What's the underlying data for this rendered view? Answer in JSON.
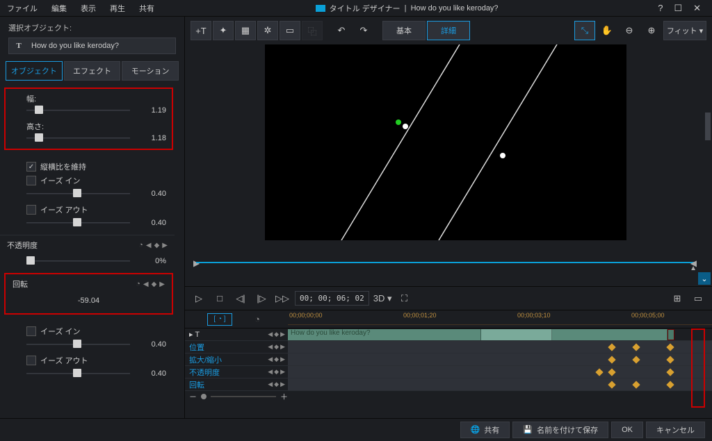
{
  "menu": {
    "file": "ファイル",
    "edit": "編集",
    "view": "表示",
    "play": "再生",
    "share": "共有"
  },
  "title": {
    "app": "タイトル デザイナー",
    "sep": "|",
    "doc": "How do you like keroday?"
  },
  "win": {
    "help": "?",
    "max": "☐",
    "close": "✕"
  },
  "selobj": {
    "heading": "選択オブジェクト:",
    "type": "T",
    "value": "How do you like keroday?"
  },
  "tabs": {
    "object": "オブジェクト",
    "effect": "エフェクト",
    "motion": "モーション"
  },
  "props": {
    "width_label": "幅:",
    "width": "1.19",
    "width_pct": 8,
    "height_label": "高さ:",
    "height": "1.18",
    "height_pct": 8,
    "keepratio": "縦横比を維持",
    "easein": "イーズ イン",
    "easein_val": "0.40",
    "easein_pct": 45,
    "easeout": "イーズ アウト",
    "easeout_val": "0.40",
    "easeout_pct": 45,
    "opacity": "不透明度",
    "opacity_val": "0%",
    "opacity_pct": 0,
    "rotation": "回転",
    "rotation_val": "-59.04",
    "easein2": "イーズ イン",
    "easein2_val": "0.40",
    "easein2_pct": 45,
    "easeout2": "イーズ アウト",
    "easeout2_val": "0.40",
    "easeout2_pct": 45
  },
  "toolbar": {
    "basic": "基本",
    "advanced": "詳細",
    "fit": "フィット"
  },
  "playback": {
    "timecode": "00; 00; 06; 02",
    "threed": "3D"
  },
  "timeline": {
    "times": [
      "00;00;00;00",
      "00;00;01;20",
      "00;00;03;10",
      "00;00;05;00"
    ],
    "caption": "How do you like keroday?",
    "rows": [
      "位置",
      "拡大/縮小",
      "不透明度",
      "回転"
    ],
    "textlabel": "▸ T"
  },
  "bottom": {
    "share": "共有",
    "saveas": "名前を付けて保存",
    "ok": "OK",
    "cancel": "キャンセル"
  }
}
